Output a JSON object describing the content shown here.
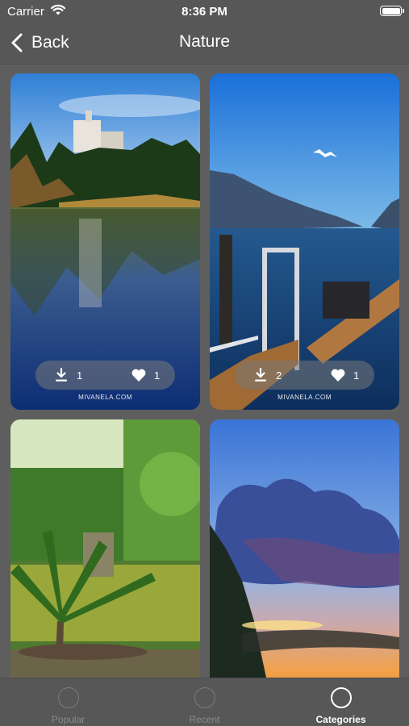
{
  "status_bar": {
    "carrier": "Carrier",
    "time": "8:36 PM"
  },
  "nav": {
    "back_label": "Back",
    "title": "Nature"
  },
  "photos": [
    {
      "downloads": "1",
      "likes": "1",
      "credit": "MIVANELA.COM"
    },
    {
      "downloads": "2",
      "likes": "1",
      "credit": "MIVANELA.COM"
    },
    {},
    {}
  ],
  "tabs": [
    {
      "label": "Popular",
      "active": false
    },
    {
      "label": "Recent",
      "active": false
    },
    {
      "label": "Categories",
      "active": true
    }
  ]
}
